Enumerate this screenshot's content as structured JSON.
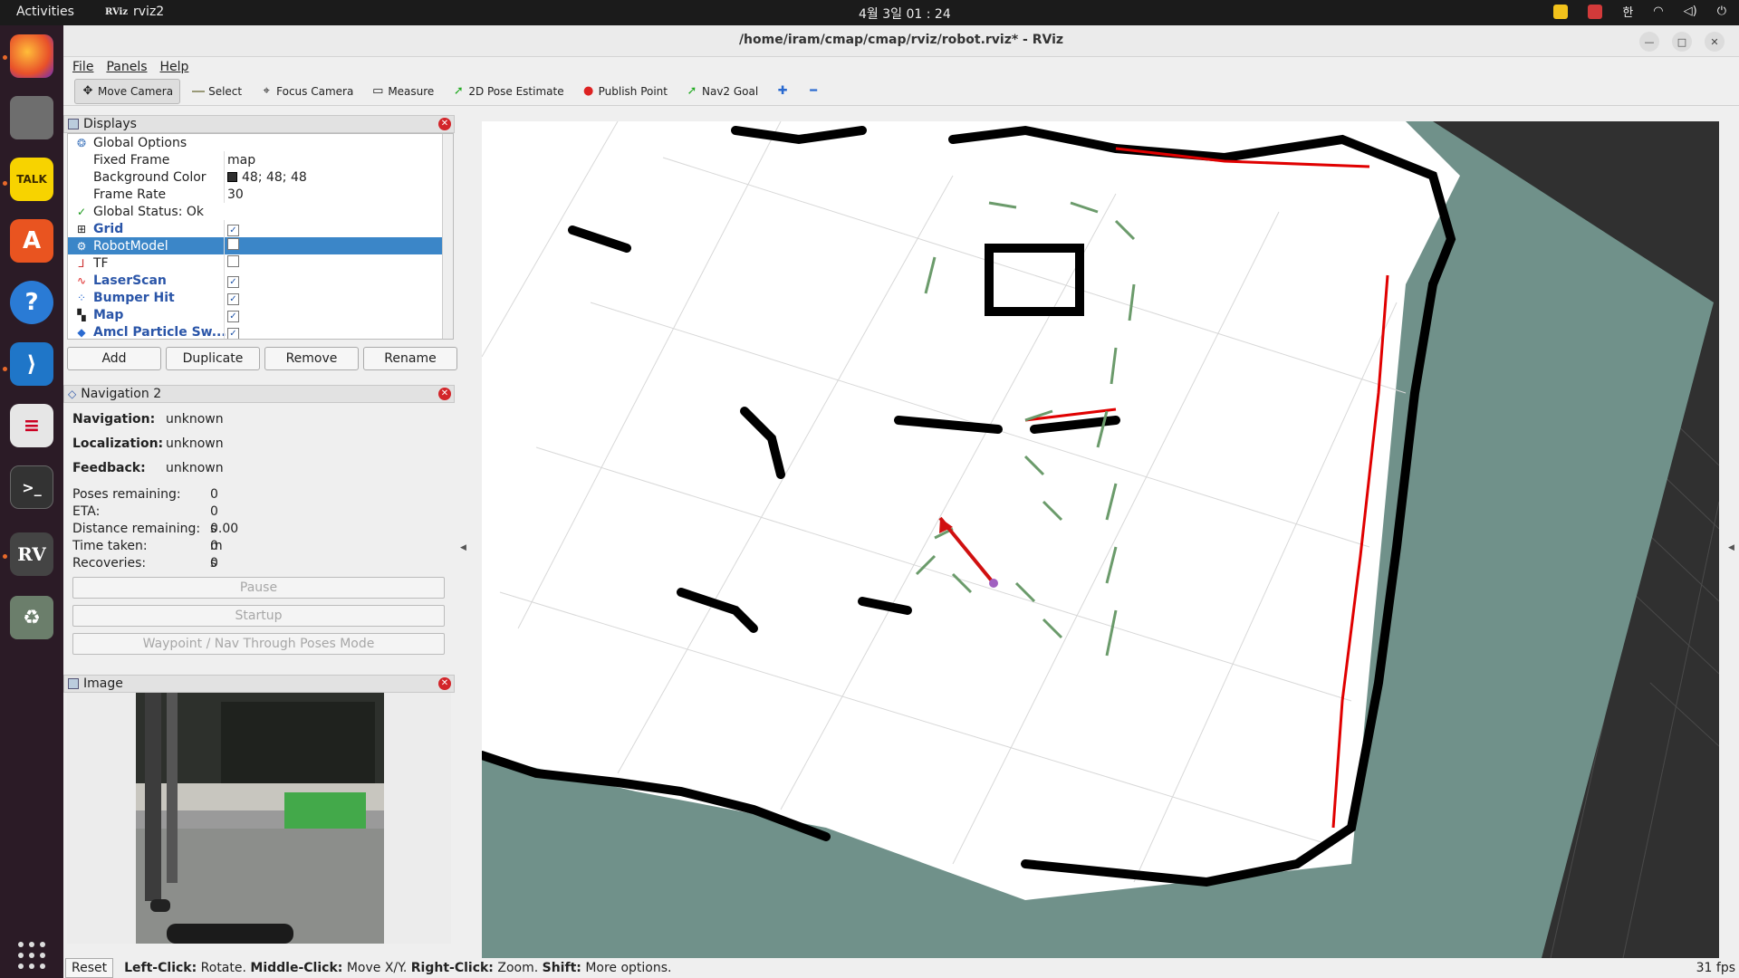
{
  "topbar": {
    "activities": "Activities",
    "app_icon": "RViz",
    "app_name": "rviz2",
    "clock": "4월 3일 01 : 24",
    "ime": "한"
  },
  "window": {
    "title": "/home/iram/cmap/cmap/rviz/robot.rviz* - RViz"
  },
  "menu": {
    "file": "File",
    "panels": "Panels",
    "help": "Help"
  },
  "toolbar": {
    "move_camera": "Move Camera",
    "select": "Select",
    "focus_camera": "Focus Camera",
    "measure": "Measure",
    "pose_estimate": "2D Pose Estimate",
    "publish_point": "Publish Point",
    "nav2_goal": "Nav2 Goal"
  },
  "displays": {
    "title": "Displays",
    "rows": [
      {
        "name": "Global Options",
        "value": ""
      },
      {
        "name": "Fixed Frame",
        "value": "map"
      },
      {
        "name": "Background Color",
        "value": "48; 48; 48"
      },
      {
        "name": "Frame Rate",
        "value": "30"
      },
      {
        "name": "Global Status: Ok",
        "value": ""
      },
      {
        "name": "Grid",
        "checked": true
      },
      {
        "name": "RobotModel",
        "checked": false
      },
      {
        "name": "TF",
        "checked": false
      },
      {
        "name": "LaserScan",
        "checked": true
      },
      {
        "name": "Bumper Hit",
        "checked": true
      },
      {
        "name": "Map",
        "checked": true
      },
      {
        "name": "Amcl Particle Sw...",
        "checked": true
      }
    ],
    "buttons": {
      "add": "Add",
      "duplicate": "Duplicate",
      "remove": "Remove",
      "rename": "Rename"
    },
    "check_mark": "✓"
  },
  "navigation": {
    "title": "Navigation 2",
    "navigation_label": "Navigation:",
    "navigation_value": "unknown",
    "localization_label": "Localization:",
    "localization_value": "unknown",
    "feedback_label": "Feedback:",
    "feedback_value": "unknown",
    "poses_label": "Poses remaining:",
    "poses_value": "0",
    "eta_label": "ETA:",
    "eta_value": "0 s",
    "distance_label": "Distance remaining:",
    "distance_value": "0.00 m",
    "time_label": "Time taken:",
    "time_value": "0 s",
    "recoveries_label": "Recoveries:",
    "recoveries_value": "0",
    "pause": "Pause",
    "startup": "Startup",
    "waypoint": "Waypoint / Nav Through Poses Mode"
  },
  "image_panel": {
    "title": "Image"
  },
  "status": {
    "reset": "Reset",
    "left_click": "Left-Click:",
    "left_action": "Rotate.",
    "middle_click": "Middle-Click:",
    "middle_action": "Move X/Y.",
    "right_click": "Right-Click:",
    "right_action": "Zoom.",
    "shift": "Shift:",
    "shift_action": "More options.",
    "fps": "31 fps"
  },
  "colors": {
    "background": "#303030",
    "map_free": "#ffffff",
    "map_unknown": "#70918a",
    "laser": "#e00000",
    "particles": "#6b9b6b",
    "pose_arrow": "#d01010"
  }
}
